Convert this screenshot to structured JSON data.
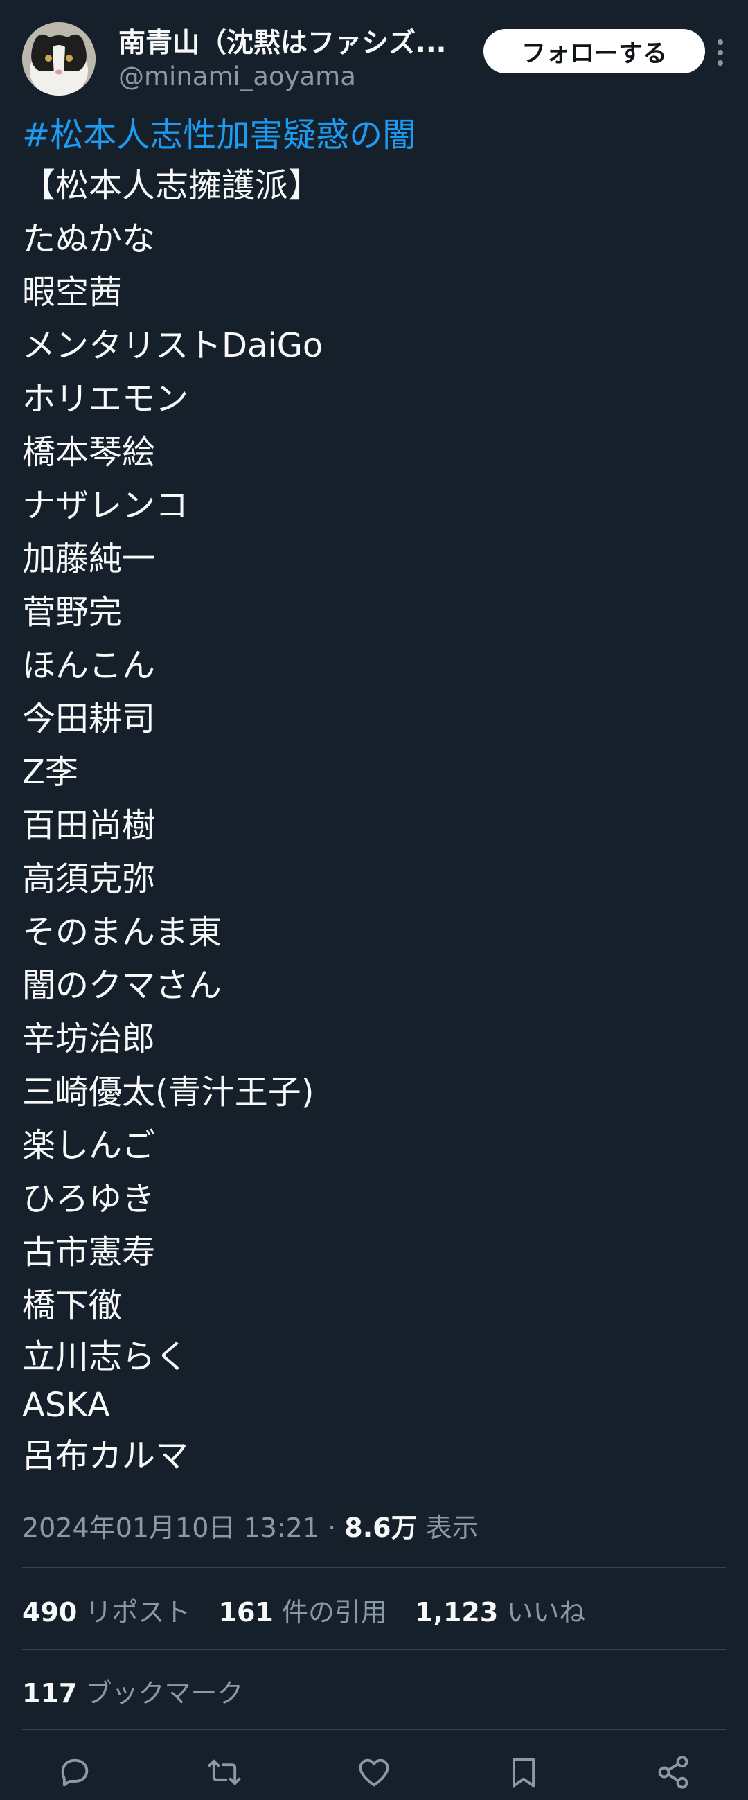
{
  "author": {
    "display_name": "南青山（沈黙はファシズ...",
    "handle": "@minami_aoyama",
    "follow_label": "フォローする"
  },
  "tweet": {
    "hashtag": "#松本人志性加害疑惑の闇",
    "lines": [
      "【松本人志擁護派】",
      "たぬかな",
      "暇空茜",
      "メンタリストDaiGo",
      "ホリエモン",
      "橋本琴絵",
      "ナザレンコ",
      "加藤純一",
      "菅野完",
      "ほんこん",
      "今田耕司",
      "Z李",
      "百田尚樹",
      "高須克弥",
      "そのまんま東",
      "闇のクマさん",
      "辛坊治郎",
      "三崎優太(青汁王子)",
      "楽しんご",
      "ひろゆき",
      "古市憲寿",
      "橋下徹",
      "立川志らく",
      "ASKA",
      "呂布カルマ"
    ]
  },
  "meta": {
    "timestamp": "2024年01月10日 13:21",
    "separator": "·",
    "views_count": "8.6万",
    "views_label": "表示"
  },
  "stats": {
    "reposts_count": "490",
    "reposts_label": "リポスト",
    "quotes_count": "161",
    "quotes_label": "件の引用",
    "likes_count": "1,123",
    "likes_label": "いいね",
    "bookmarks_count": "117",
    "bookmarks_label": "ブックマーク"
  },
  "actions": [
    "reply-icon",
    "repost-icon",
    "like-icon",
    "bookmark-icon",
    "share-icon"
  ],
  "colors": {
    "background": "#15202b",
    "text": "#f7f9f9",
    "secondary_text": "#8b98a5",
    "link": "#1d9bf0",
    "divider": "#38444d"
  }
}
